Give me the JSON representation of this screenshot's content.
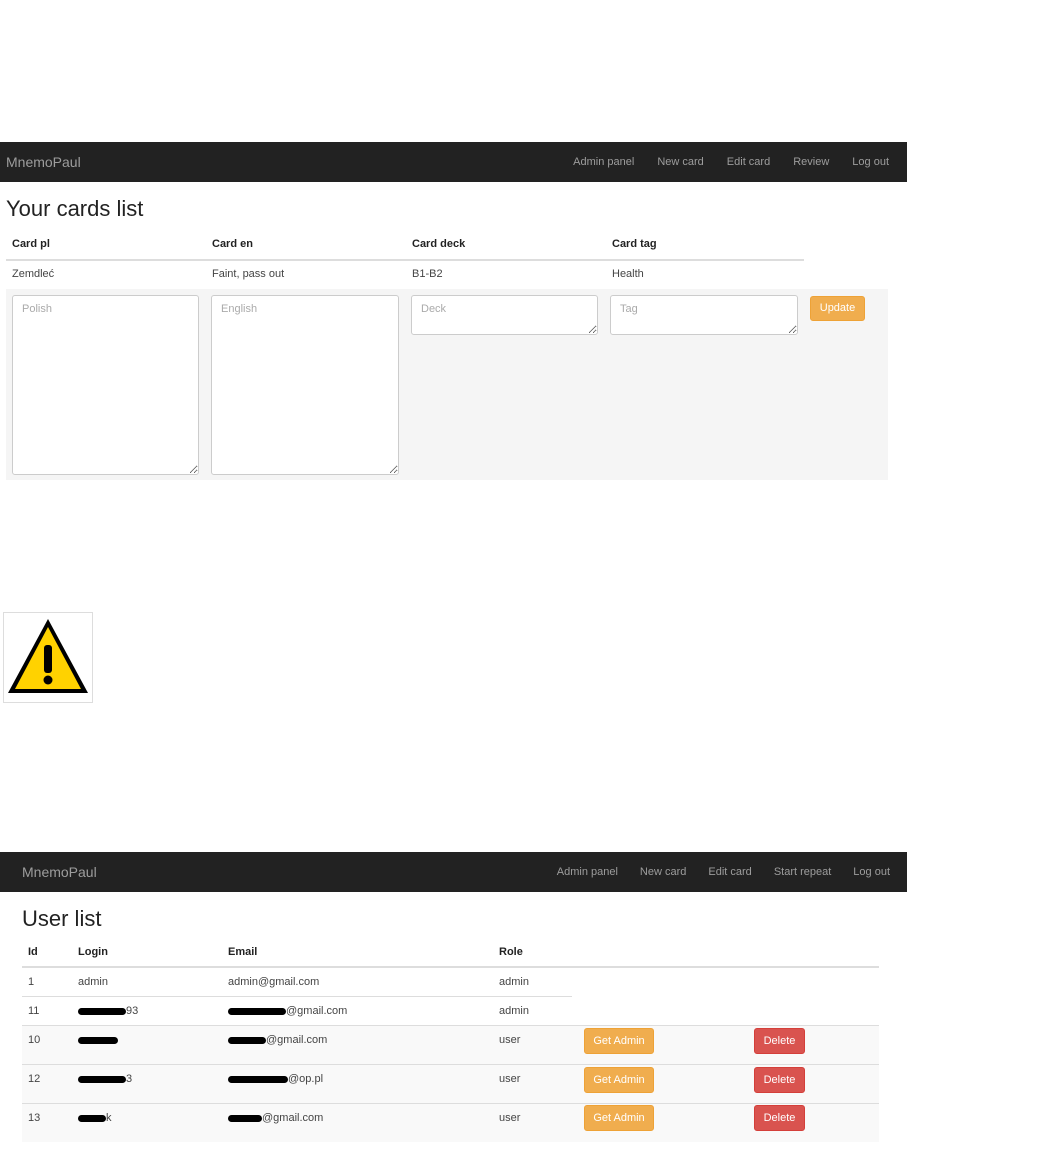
{
  "nav1": {
    "brand": "MnemoPaul",
    "links": [
      "Admin panel",
      "New card",
      "Edit card",
      "Review",
      "Log out"
    ]
  },
  "cards": {
    "title": "Your cards list",
    "headers": [
      "Card pl",
      "Card en",
      "Card deck",
      "Card tag"
    ],
    "row": [
      "Zemdleć",
      "Faint, pass out",
      "B1-B2",
      "Health"
    ],
    "placeholders": {
      "polish": "Polish",
      "english": "English",
      "deck": "Deck",
      "tag": "Tag"
    },
    "update_label": "Update"
  },
  "warning_icon": "warning-triangle-icon",
  "nav2": {
    "brand": "MnemoPaul",
    "links": [
      "Admin panel",
      "New card",
      "Edit card",
      "Start repeat",
      "Log out"
    ]
  },
  "users": {
    "title": "User list",
    "headers": [
      "Id",
      "Login",
      "Email",
      "Role"
    ],
    "rows": [
      {
        "id": "1",
        "login": "admin",
        "email": "admin@gmail.com",
        "role": "admin"
      },
      {
        "id": "11",
        "login": "93",
        "email": "@gmail.com",
        "role": "admin"
      },
      {
        "id": "10",
        "login": "",
        "email": "@gmail.com",
        "role": "user"
      },
      {
        "id": "12",
        "login": "3",
        "email": "@op.pl",
        "role": "user"
      },
      {
        "id": "13",
        "login": "k",
        "email": "@gmail.com",
        "role": "user"
      }
    ],
    "get_admin_label": "Get Admin",
    "delete_label": "Delete"
  },
  "colors": {
    "navbar": "#222222",
    "warning": "#f0ad4e",
    "danger": "#d9534f"
  }
}
